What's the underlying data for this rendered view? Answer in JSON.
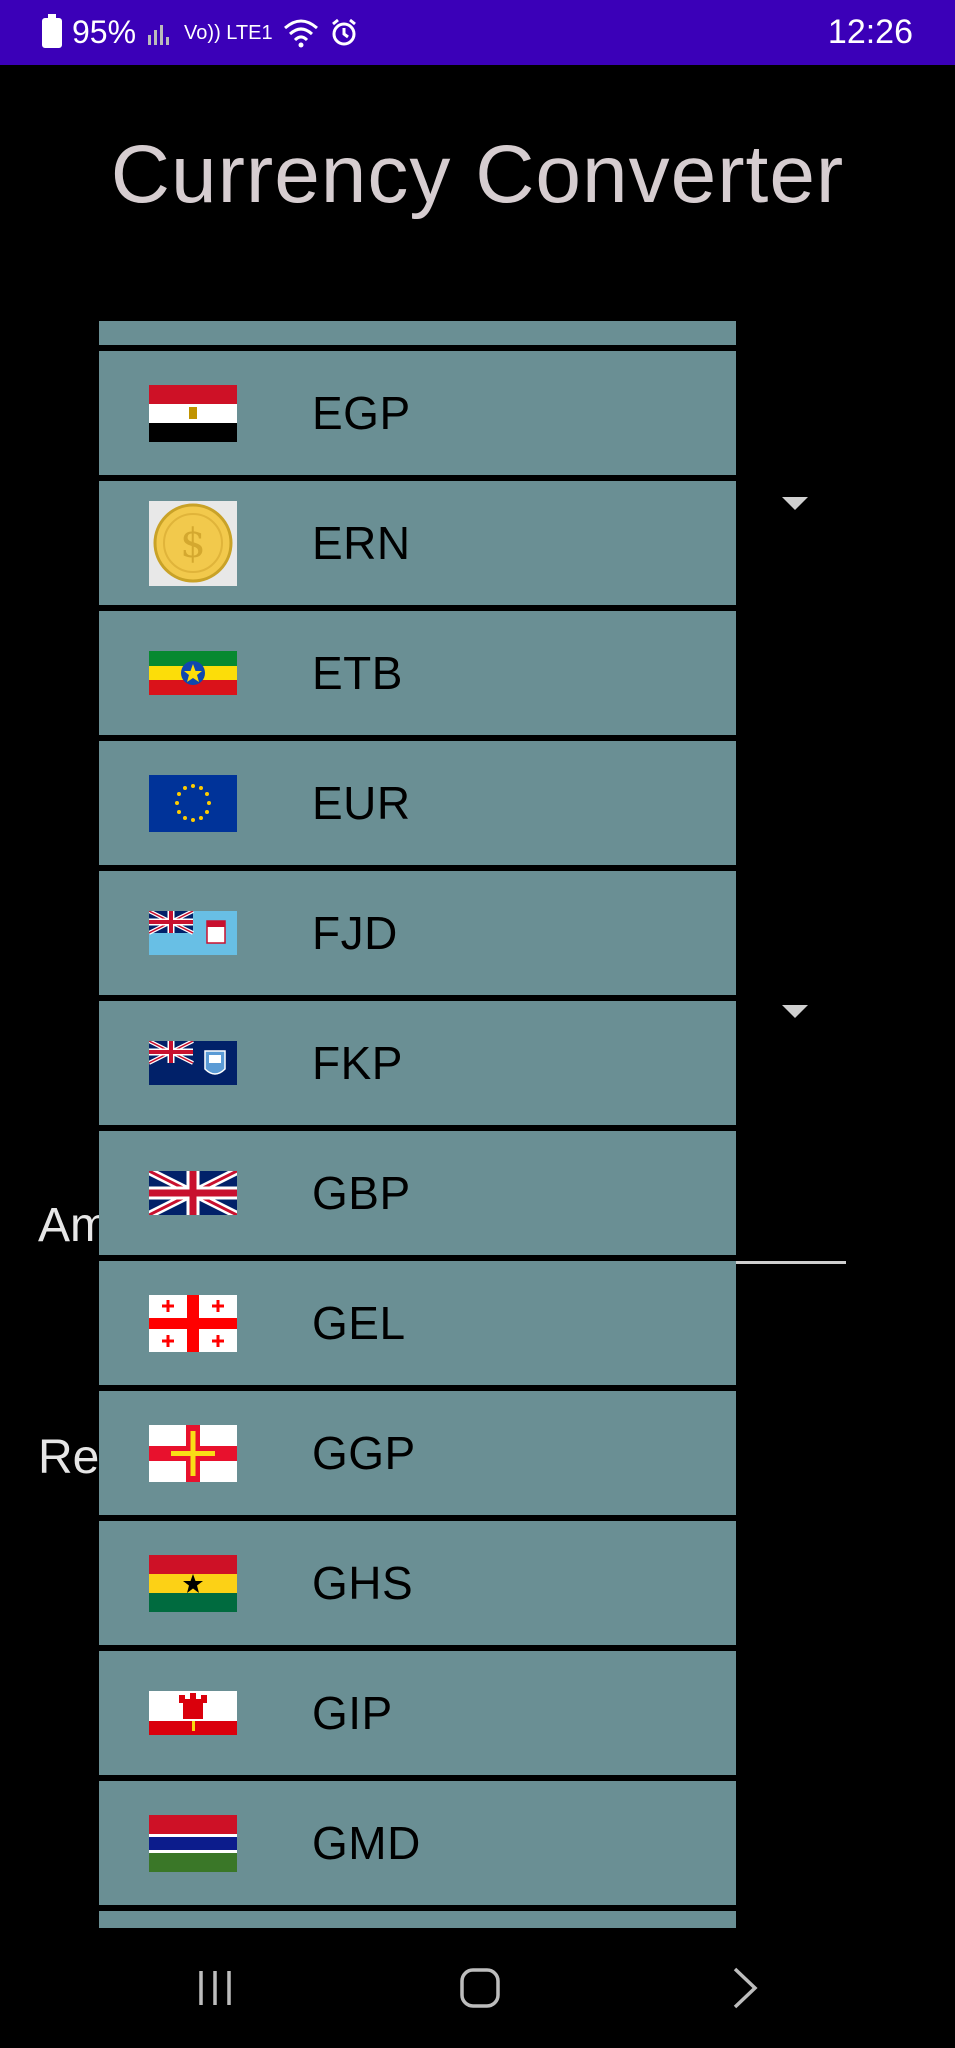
{
  "status_bar": {
    "battery": "95%",
    "network_label": "Vo)) LTE1",
    "time": "12:26",
    "icons": [
      "battery-icon",
      "signal-icon",
      "volte-icon",
      "wifi-icon",
      "alarm-icon"
    ]
  },
  "app": {
    "title": "Currency Converter"
  },
  "background_labels": {
    "amount": "Am",
    "result": "Res"
  },
  "dropdown": {
    "items": [
      {
        "code": "EGP",
        "flag": "egypt-flag-icon"
      },
      {
        "code": "ERN",
        "flag": "gold-coin-icon"
      },
      {
        "code": "ETB",
        "flag": "ethiopia-flag-icon"
      },
      {
        "code": "EUR",
        "flag": "eu-flag-icon"
      },
      {
        "code": "FJD",
        "flag": "fiji-flag-icon"
      },
      {
        "code": "FKP",
        "flag": "falkland-flag-icon"
      },
      {
        "code": "GBP",
        "flag": "uk-flag-icon"
      },
      {
        "code": "GEL",
        "flag": "georgia-flag-icon"
      },
      {
        "code": "GGP",
        "flag": "guernsey-flag-icon"
      },
      {
        "code": "GHS",
        "flag": "ghana-flag-icon"
      },
      {
        "code": "GIP",
        "flag": "gibraltar-flag-icon"
      },
      {
        "code": "GMD",
        "flag": "gambia-flag-icon"
      }
    ]
  },
  "nav_bar": {
    "icons": [
      "recents-icon",
      "home-icon",
      "back-icon"
    ]
  },
  "colors": {
    "status_bar": "#3b00b8",
    "row_bg": "#6a8f94",
    "title": "#d6cdd0"
  }
}
